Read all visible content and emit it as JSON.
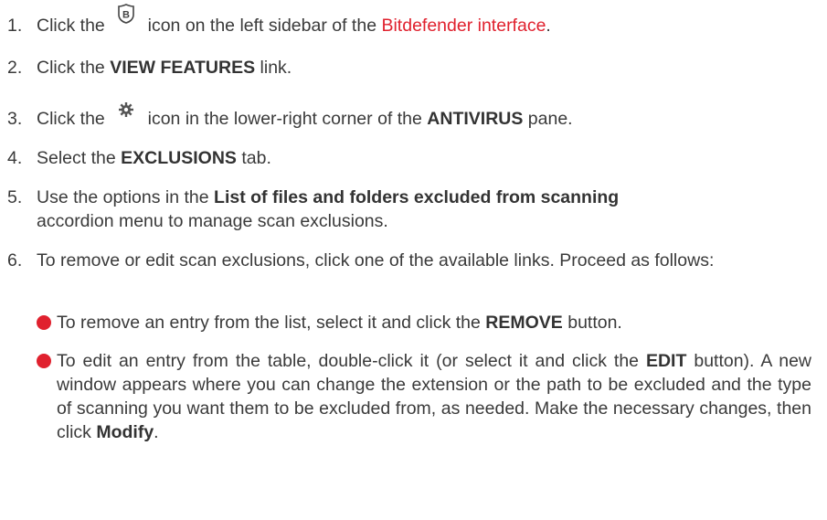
{
  "steps": [
    {
      "num": "1.",
      "pre": "Click the",
      "mid": "icon on the left sidebar of the",
      "link": "Bitdefender interface",
      "post": "."
    },
    {
      "num": "2.",
      "pre": "Click the",
      "bold": "VIEW FEATURES",
      "post": "link."
    },
    {
      "num": "3.",
      "pre": "Click the",
      "mid": "icon in the lower-right corner of the",
      "bold": "ANTIVIRUS",
      "post": "pane."
    },
    {
      "num": "4.",
      "pre": "Select the",
      "bold": "EXCLUSIONS",
      "post": "tab."
    },
    {
      "num": "5.",
      "pre": "Use the options in the",
      "bold": "List of files and folders excluded from scanning",
      "post": "accordion menu to manage scan exclusions."
    },
    {
      "num": "6.",
      "text": "To remove or edit scan exclusions, click one of the available links. Proceed as follows:"
    }
  ],
  "bullets": [
    {
      "pre": "To remove an entry from the list, select it and click the",
      "bold": "REMOVE",
      "post": "button."
    },
    {
      "pre": "To edit an entry from the table, double-click it (or select it and click the",
      "bold": "EDIT",
      "mid": "button). A new window appears where you can change the extension or the path to be excluded and the type of scanning you want them to be excluded from, as needed. Make the necessary changes, then click",
      "bold2": "Modify",
      "post": "."
    }
  ],
  "icons": {
    "step1": "bitdefender-b-icon",
    "step3": "gear-icon"
  },
  "colors": {
    "accent": "#e0212e",
    "text": "#3a3a3a"
  }
}
